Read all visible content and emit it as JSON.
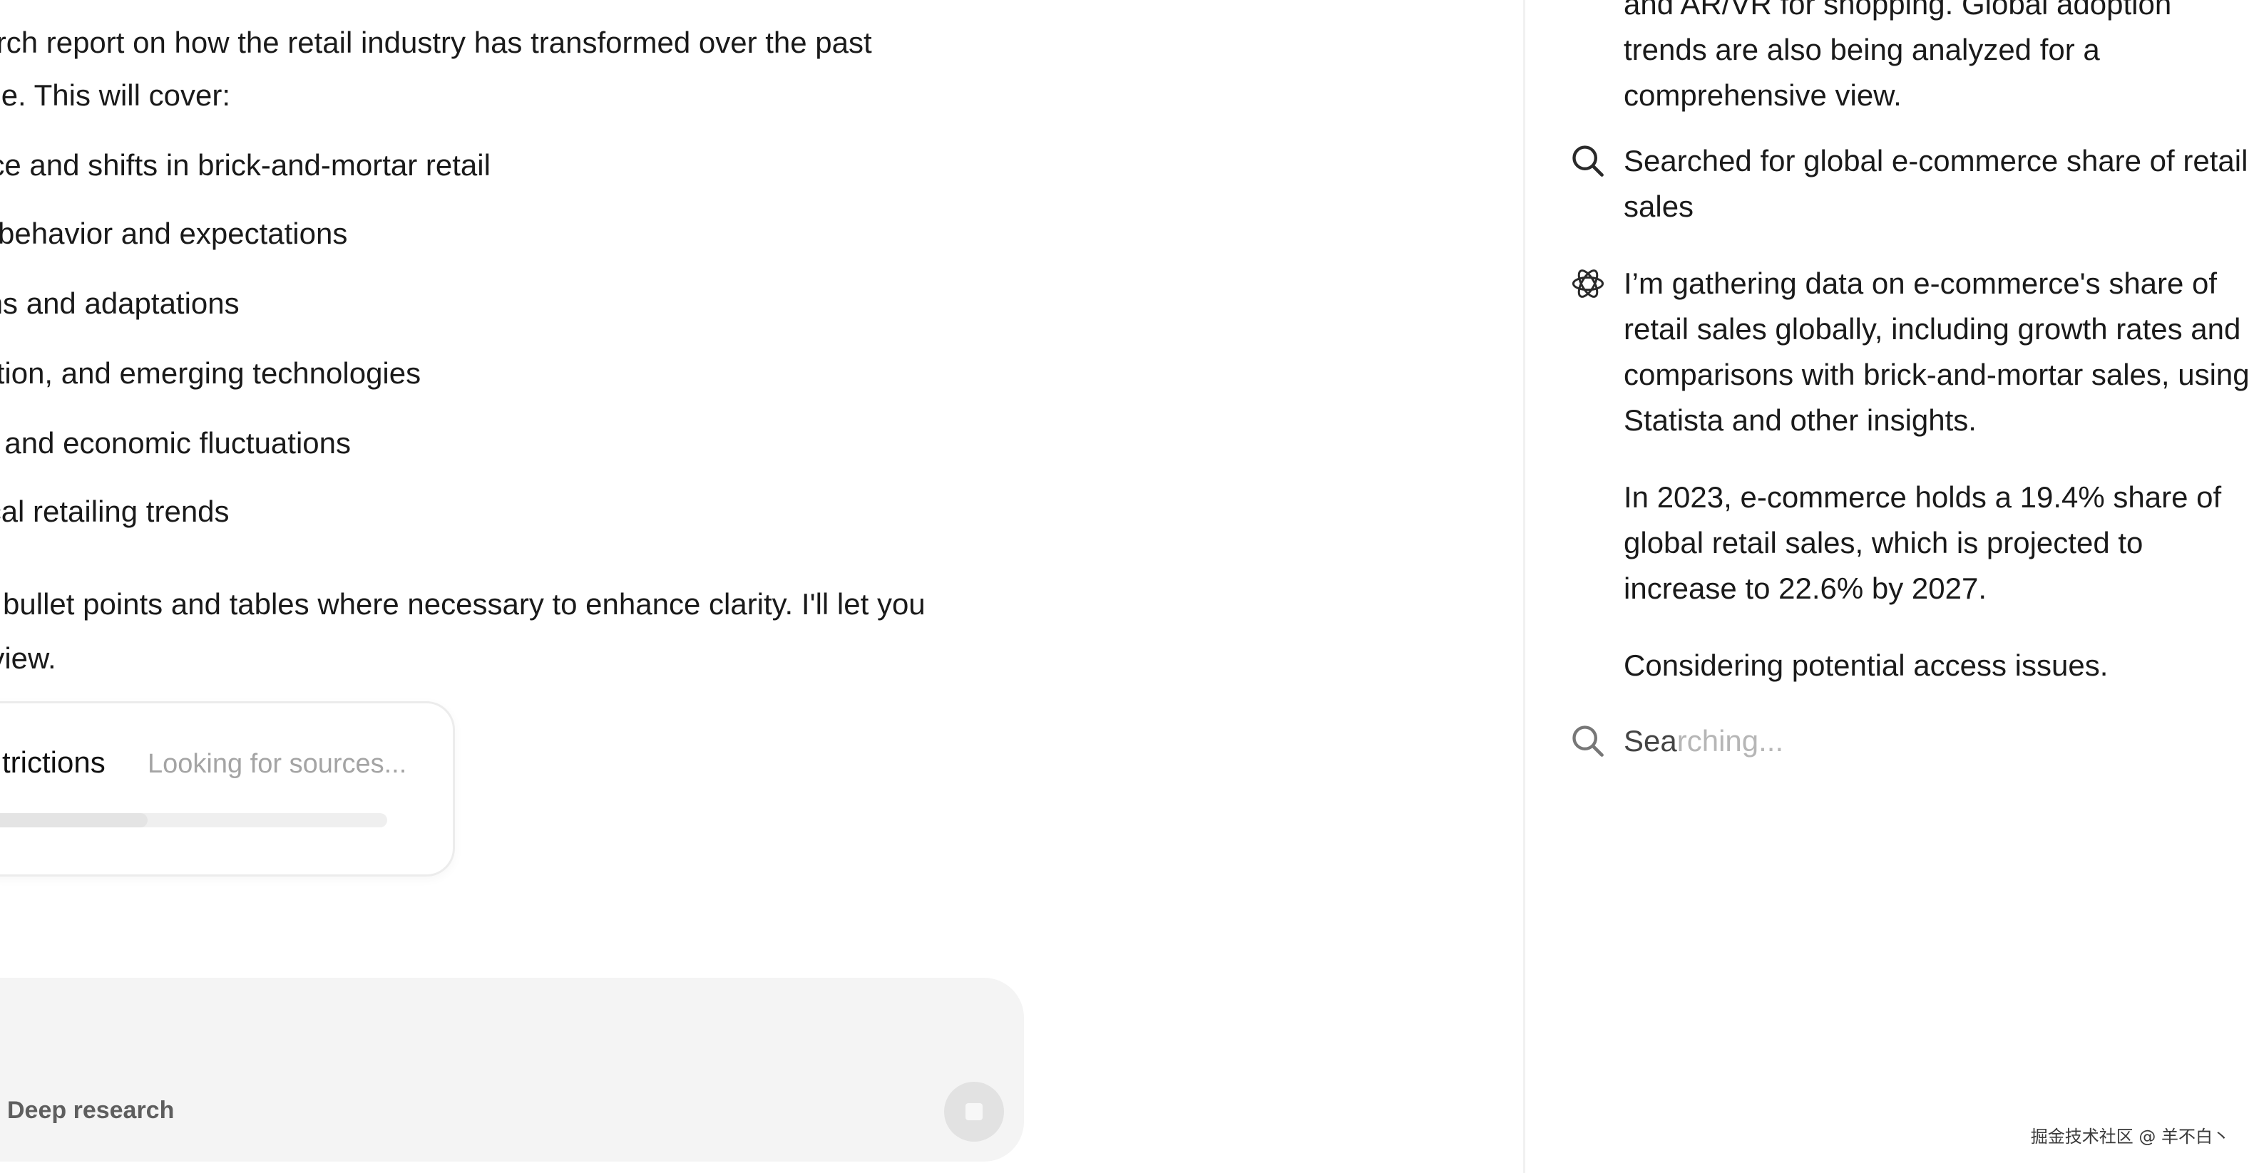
{
  "chat": {
    "lines": [
      "earch report on how the retail industry has transformed over the past",
      "cale. This will cover:",
      "erce and shifts in brick-and-mortar retail",
      "er behavior and expectations",
      "ions and adaptations",
      "nation, and emerging technologies",
      "on and economic fluctuations",
      "nical retailing trends",
      "ith bullet points and tables where necessary to enhance clarity. I'll let you",
      "review."
    ],
    "status_card": {
      "title": "trictions",
      "subtitle": "Looking for sources...",
      "progress": 0.4
    }
  },
  "composer": {
    "mode_label": "Deep research",
    "stop_icon": "stop-square-icon"
  },
  "activity": {
    "top_text": "and AR/VR for shopping. Global adoption trends are also being analyzed for a comprehensive view.",
    "search_1": "Searched for global e-commerce share of retail sales",
    "thought_1": "I’m gathering data on e-commerce's share of retail sales globally, including growth rates and comparisons with brick-and-mortar sales, using Statista and other insights.",
    "thought_2": "In 2023, e-commerce holds a 19.4% share of global retail sales, which is projected to increase to 22.6% by 2027.",
    "thought_3": "Considering potential access issues.",
    "searching_start": "Sea",
    "searching_rest": "rching...",
    "icons": {
      "search": "search-icon",
      "logo": "openai-logo-icon"
    }
  },
  "watermark": "掘金技术社区 @ 羊不白丶",
  "colors": {
    "text": "#1a1a1a",
    "muted": "#a4a4a4",
    "composer_bg": "#f4f4f4"
  }
}
